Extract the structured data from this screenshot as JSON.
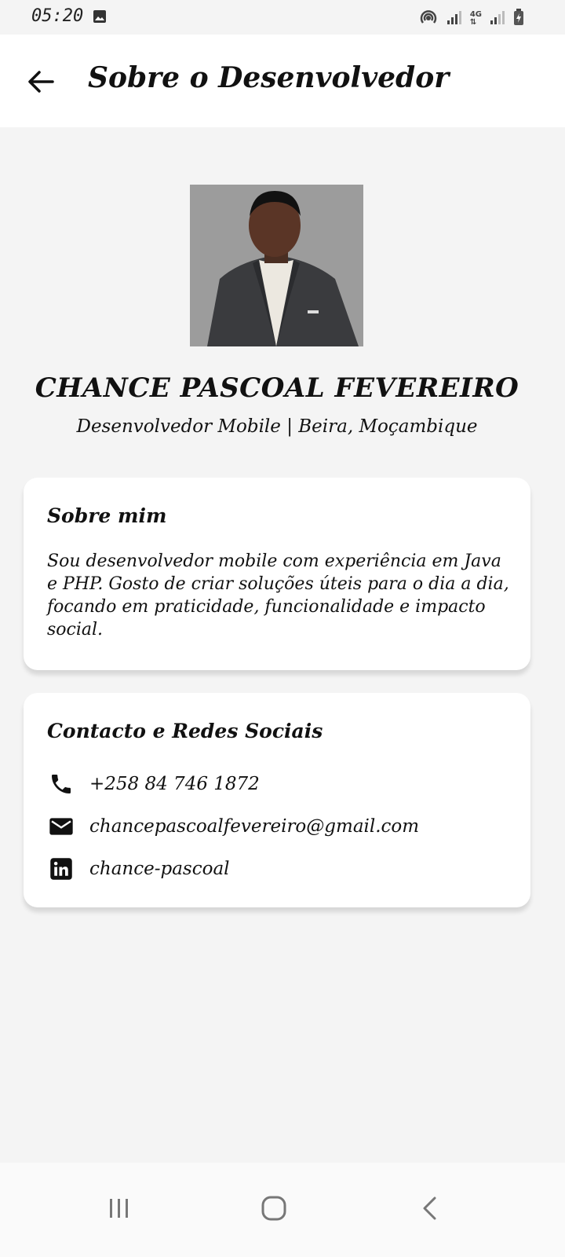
{
  "status_bar": {
    "time": "05:20",
    "icons": [
      "image-icon",
      "hotspot-icon",
      "signal-icon",
      "4g-icon",
      "signal-icon-2",
      "battery-charging-icon"
    ]
  },
  "app_bar": {
    "title": "Sobre o Desenvolvedor",
    "back_icon": "arrow-back-icon"
  },
  "profile": {
    "name": "CHANCE PASCOAL FEVEREIRO",
    "role": "Desenvolvedor Mobile | Beira, Moçambique"
  },
  "about": {
    "title": "Sobre mim",
    "text": "Sou desenvolvedor mobile com experiência em Java e PHP. Gosto de criar soluções úteis para o dia a dia, focando em praticidade, funcionalidade e impacto social."
  },
  "contact": {
    "title": "Contacto e Redes Sociais",
    "items": [
      {
        "icon": "phone-icon",
        "text": "+258 84 746 1872"
      },
      {
        "icon": "email-icon",
        "text": "chancepascoalfevereiro@gmail.com"
      },
      {
        "icon": "linkedin-icon",
        "text": "chance-pascoal"
      }
    ]
  },
  "nav": {
    "icons": [
      "recents-icon",
      "home-icon",
      "back-icon"
    ]
  },
  "colors": {
    "background": "#f4f4f4",
    "card": "#ffffff",
    "text": "#111111"
  }
}
